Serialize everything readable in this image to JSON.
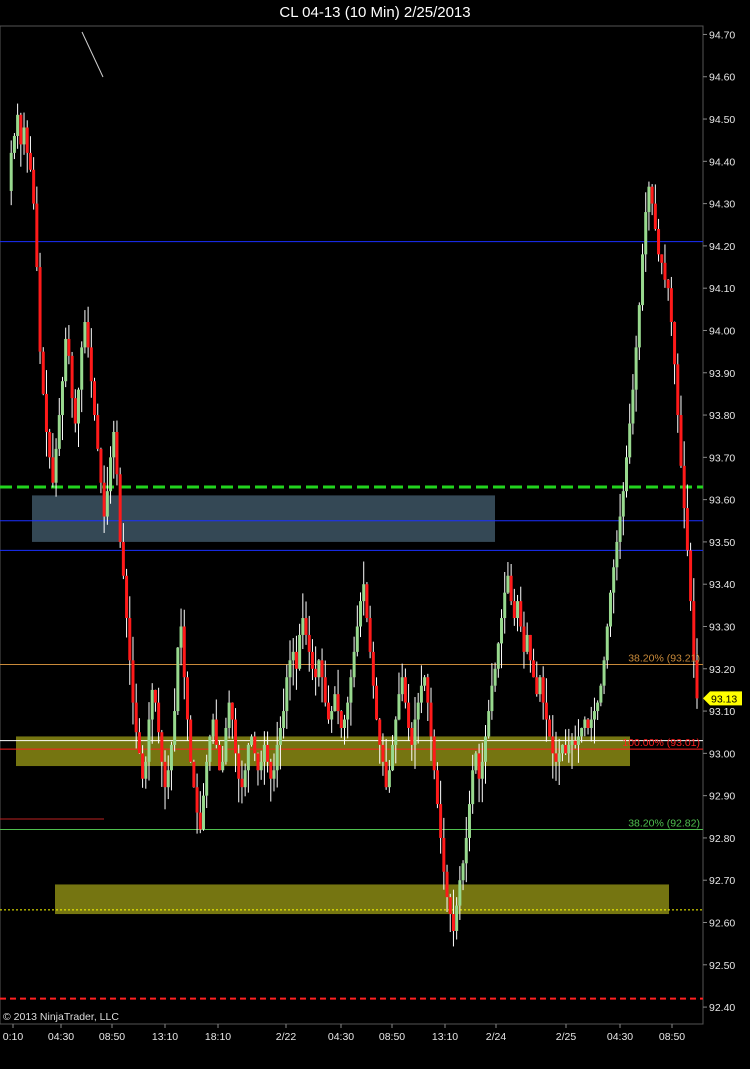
{
  "title": "CL 04-13 (10 Min)  2/25/2013",
  "copyright": "© 2013 NinjaTrader, LLC",
  "colors": {
    "background": "#000000",
    "up_candle": "#98d98e",
    "down_candle": "#ff1a1a",
    "wick": "#ffffff",
    "support_line": "#1a2fff",
    "green_dashed": "#22d41e",
    "red_dashed": "#ff2020",
    "fib_orange": "#c98a3a",
    "fib_green": "#4fbf4f",
    "box_gray": "#3d5564",
    "box_yellow": "#8a8a14",
    "price_marker": "#ffff00"
  },
  "chart_data": {
    "type": "candlestick",
    "instrument": "CL 04-13",
    "interval": "10 Min",
    "ylim": [
      92.36,
      94.72
    ],
    "y_ticks": [
      "94.70",
      "94.60",
      "94.50",
      "94.40",
      "94.30",
      "94.20",
      "94.10",
      "94.00",
      "93.90",
      "93.80",
      "93.70",
      "93.60",
      "93.50",
      "93.40",
      "93.30",
      "93.20",
      "93.10",
      "93.00",
      "92.90",
      "92.80",
      "92.70",
      "92.60",
      "92.50",
      "92.40"
    ],
    "x_ticks": [
      "0:10",
      "04:30",
      "08:50",
      "13:10",
      "18:10",
      "2/22",
      "04:30",
      "08:50",
      "13:10",
      "2/24",
      "2/25",
      "04:30",
      "08:50"
    ],
    "last_price": "93.13",
    "horizontal_lines": [
      {
        "price": 94.21,
        "style": "solid",
        "color": "support_line"
      },
      {
        "price": 93.63,
        "style": "dashed",
        "color": "green_dashed"
      },
      {
        "price": 93.55,
        "style": "solid",
        "color": "support_line"
      },
      {
        "price": 93.48,
        "style": "solid",
        "color": "support_line"
      },
      {
        "price": 93.21,
        "style": "solid",
        "color": "fib_orange"
      },
      {
        "price": 93.03,
        "style": "solid",
        "color": "wick"
      },
      {
        "price": 93.01,
        "style": "solid",
        "color": "red_dashed"
      },
      {
        "price": 92.82,
        "style": "solid",
        "color": "fib_green"
      },
      {
        "price": 92.63,
        "style": "dotted",
        "color": "price_marker"
      },
      {
        "price": 92.42,
        "style": "dashed",
        "color": "red_dashed"
      }
    ],
    "fib_labels": [
      {
        "text": "38.20% (93.21)",
        "price": 93.21,
        "color": "fib_orange"
      },
      {
        "text": "100.00% (93.01)",
        "price": 93.01,
        "color": "red_dashed"
      },
      {
        "text": "38.20% (92.82)",
        "price": 92.82,
        "color": "fib_green"
      }
    ],
    "zones": [
      {
        "from_price": 93.5,
        "to_price": 93.61,
        "color": "box_gray"
      },
      {
        "from_price": 92.97,
        "to_price": 93.04,
        "color": "box_yellow"
      },
      {
        "from_price": 92.62,
        "to_price": 92.69,
        "color": "box_yellow"
      }
    ],
    "price_path": [
      94.33,
      94.42,
      94.46,
      94.51,
      94.44,
      94.48,
      94.42,
      94.38,
      94.3,
      94.15,
      93.95,
      93.85,
      93.76,
      93.7,
      93.64,
      93.72,
      93.8,
      93.88,
      93.98,
      93.94,
      93.84,
      93.78,
      93.86,
      93.96,
      94.02,
      93.96,
      93.88,
      93.8,
      93.72,
      93.64,
      93.56,
      93.62,
      93.7,
      93.76,
      93.66,
      93.5,
      93.42,
      93.32,
      93.22,
      93.12,
      93.05,
      93.0,
      92.94,
      92.98,
      93.08,
      93.15,
      93.12,
      93.05,
      92.98,
      92.92,
      92.96,
      93.02,
      93.1,
      93.25,
      93.3,
      93.18,
      93.08,
      92.98,
      92.92,
      92.86,
      92.82,
      92.9,
      92.98,
      93.04,
      93.08,
      93.02,
      92.96,
      92.98,
      93.06,
      93.12,
      93.08,
      93.0,
      92.94,
      92.92,
      92.96,
      93.02,
      93.04,
      93.0,
      92.96,
      92.98,
      93.02,
      92.98,
      92.94,
      92.96,
      93.02,
      93.06,
      93.1,
      93.18,
      93.22,
      93.24,
      93.2,
      93.28,
      93.32,
      93.28,
      93.24,
      93.2,
      93.18,
      93.22,
      93.18,
      93.12,
      93.08,
      93.1,
      93.14,
      93.1,
      93.06,
      93.08,
      93.12,
      93.18,
      93.24,
      93.3,
      93.36,
      93.4,
      93.32,
      93.24,
      93.16,
      93.08,
      93.02,
      92.98,
      92.92,
      92.96,
      93.02,
      93.08,
      93.14,
      93.18,
      93.12,
      93.06,
      93.02,
      93.08,
      93.12,
      93.16,
      93.18,
      93.12,
      93.04,
      92.96,
      92.88,
      92.8,
      92.72,
      92.66,
      92.62,
      92.58,
      92.64,
      92.7,
      92.74,
      92.8,
      92.88,
      92.96,
      93.0,
      92.94,
      92.98,
      93.04,
      93.1,
      93.16,
      93.2,
      93.26,
      93.32,
      93.38,
      93.42,
      93.36,
      93.32,
      93.36,
      93.3,
      93.24,
      93.28,
      93.22,
      93.18,
      93.14,
      93.18,
      93.12,
      93.08,
      93.04,
      93.0,
      92.98,
      93.0,
      93.02,
      93.0,
      93.02,
      93.03,
      93.02,
      93.04,
      93.06,
      93.08,
      93.06,
      93.08,
      93.1,
      93.12,
      93.16,
      93.22,
      93.3,
      93.38,
      93.44,
      93.5,
      93.56,
      93.62,
      93.7,
      93.78,
      93.86,
      93.96,
      94.06,
      94.18,
      94.28,
      94.34,
      94.3,
      94.24,
      94.18,
      94.16,
      94.12,
      94.1,
      94.02,
      93.92,
      93.8,
      93.68,
      93.58,
      93.48,
      93.36,
      93.22,
      93.13
    ]
  }
}
